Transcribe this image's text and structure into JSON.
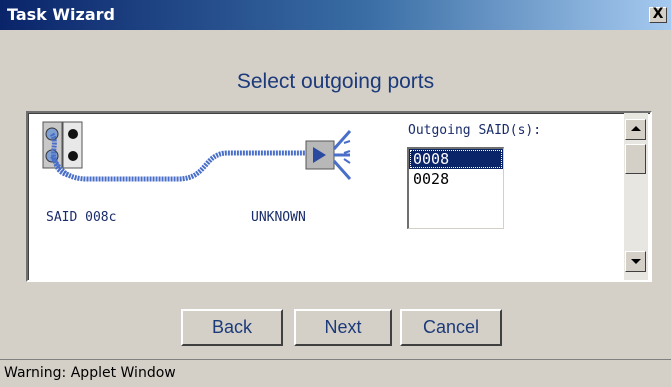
{
  "window": {
    "title": "Task Wizard",
    "close_label": "X"
  },
  "page": {
    "heading": "Select outgoing ports"
  },
  "diagram": {
    "source_label": "SAID 008c",
    "target_label": "UNKNOWN",
    "source_icon": "port-connector-icon",
    "target_icon": "switch-device-icon"
  },
  "outgoing": {
    "label": "Outgoing SAID(s):",
    "items": [
      {
        "value": "0008",
        "selected": true
      },
      {
        "value": "0028",
        "selected": false
      }
    ]
  },
  "buttons": {
    "back": "Back",
    "next": "Next",
    "cancel": "Cancel"
  },
  "status": {
    "text": "Warning: Applet Window"
  },
  "colors": {
    "title_bar": "#0a246a",
    "selection": "#0a246a",
    "heading_text": "#1c3a7a",
    "window_bg": "#d4d0c8"
  }
}
